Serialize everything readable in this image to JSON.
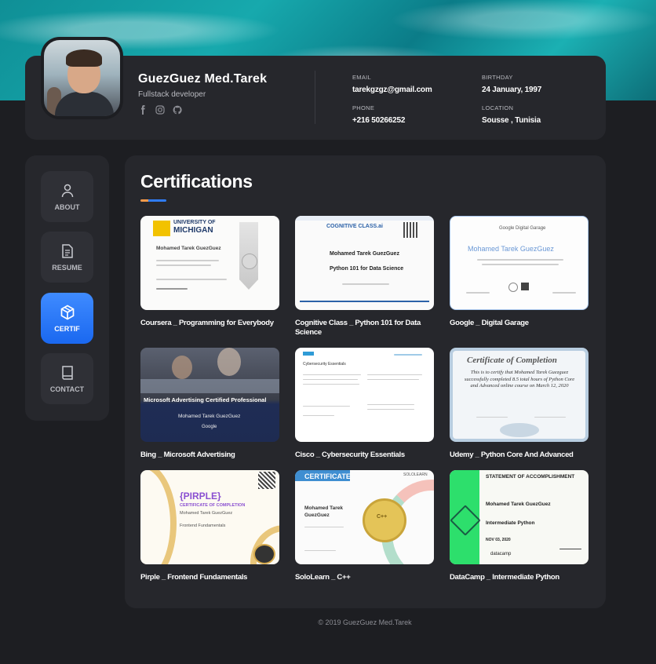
{
  "profile": {
    "name": "GuezGuez Med.Tarek",
    "role": "Fullstack developer",
    "socials": [
      {
        "icon": "facebook-icon"
      },
      {
        "icon": "instagram-icon"
      },
      {
        "icon": "github-icon"
      }
    ],
    "email_label": "EMAIL",
    "email": "tarekgzgz@gmail.com",
    "phone_label": "PHONE",
    "phone": "+216 50266252",
    "birthday_label": "BIRTHDAY",
    "birthday": "24 January, 1997",
    "location_label": "LOCATION",
    "location": "Sousse , Tunisia"
  },
  "nav": [
    {
      "label": "ABOUT",
      "icon": "user-icon",
      "active": false
    },
    {
      "label": "RESUME",
      "icon": "document-icon",
      "active": false
    },
    {
      "label": "CERTIF",
      "icon": "cube-icon",
      "active": true
    },
    {
      "label": "CONTACT",
      "icon": "book-icon",
      "active": false
    }
  ],
  "section_title": "Certifications",
  "certificates": [
    {
      "caption": "Coursera _ Programming for Everybody",
      "thumb_text": [
        "UNIVERSITY OF",
        "MICHIGAN",
        "Mohamed Tarek GuezGuez"
      ]
    },
    {
      "caption": "Cognitive Class _ Python 101 for Data Science",
      "thumb_text": [
        "COGNITIVE CLASS.ai",
        "Mohamed Tarek GuezGuez",
        "Python 101 for Data Science"
      ]
    },
    {
      "caption": "Google _ Digital Garage",
      "thumb_text": [
        "Google Digital Garage",
        "Mohamed Tarek GuezGuez"
      ]
    },
    {
      "caption": "Bing _ Microsoft Advertising",
      "thumb_text": [
        "Microsoft Advertising Certified Professional",
        "Mohamed Tarek GuezGuez",
        "Google"
      ]
    },
    {
      "caption": "Cisco _ Cybersecurity Essentials",
      "thumb_text": [
        "Cybersecurity Essentials"
      ]
    },
    {
      "caption": "Udemy _ Python Core And Advanced",
      "thumb_text": [
        "Certificate of Completion",
        "This is to certify that Mohamed Tarek Guezguez successfully completed 8.5 total hours of Python Core and Advanced online course on March 12, 2020"
      ]
    },
    {
      "caption": "Pirple _ Frontend Fundamentals",
      "thumb_text": [
        "{PIRPLE}",
        "CERTIFICATE OF COMPLETION",
        "Mohamed Tarek GuezGuez",
        "Frontend Fundamentals"
      ]
    },
    {
      "caption": "SoloLearn _ C++",
      "thumb_text": [
        "CERTIFICATE",
        "SOLOLEARN",
        "Mohamed Tarek GuezGuez",
        "C++"
      ]
    },
    {
      "caption": "DataCamp _ Intermediate Python",
      "thumb_text": [
        "STATEMENT OF ACCOMPLISHMENT",
        "Mohamed Tarek GuezGuez",
        "Intermediate Python",
        "NOV 03, 2020",
        "datacamp"
      ]
    }
  ],
  "footer": "© 2019 GuezGuez Med.Tarek",
  "colors": {
    "accent": "#2f7cf6",
    "accent_orange": "#f59a4b",
    "bg": "#1d1e22",
    "card": "#26272c"
  }
}
